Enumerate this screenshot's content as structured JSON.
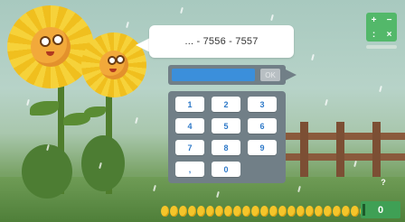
{
  "colors": {
    "sky": "#a8c9bf",
    "grass": "#4f7f39",
    "accent_blue": "#3b8fdb",
    "panel": "#717f87",
    "coin": "#f5c52a",
    "score_bg": "#3fa055"
  },
  "corner_controls": {
    "plus": "+",
    "minus": "−",
    "pause": ":",
    "close": "×"
  },
  "question": {
    "text": "... - 7556 - 7557"
  },
  "answer": {
    "value": "",
    "ok_label": "OK"
  },
  "keypad": {
    "keys": [
      "1",
      "2",
      "3",
      "4",
      "5",
      "6",
      "7",
      "8",
      "9",
      ",",
      "0"
    ]
  },
  "coins": {
    "count": 24
  },
  "score": {
    "value": "0"
  },
  "help": {
    "label": "?"
  },
  "icons": {
    "mascot": "sunflower-character",
    "coin": "gold-coin-icon"
  }
}
